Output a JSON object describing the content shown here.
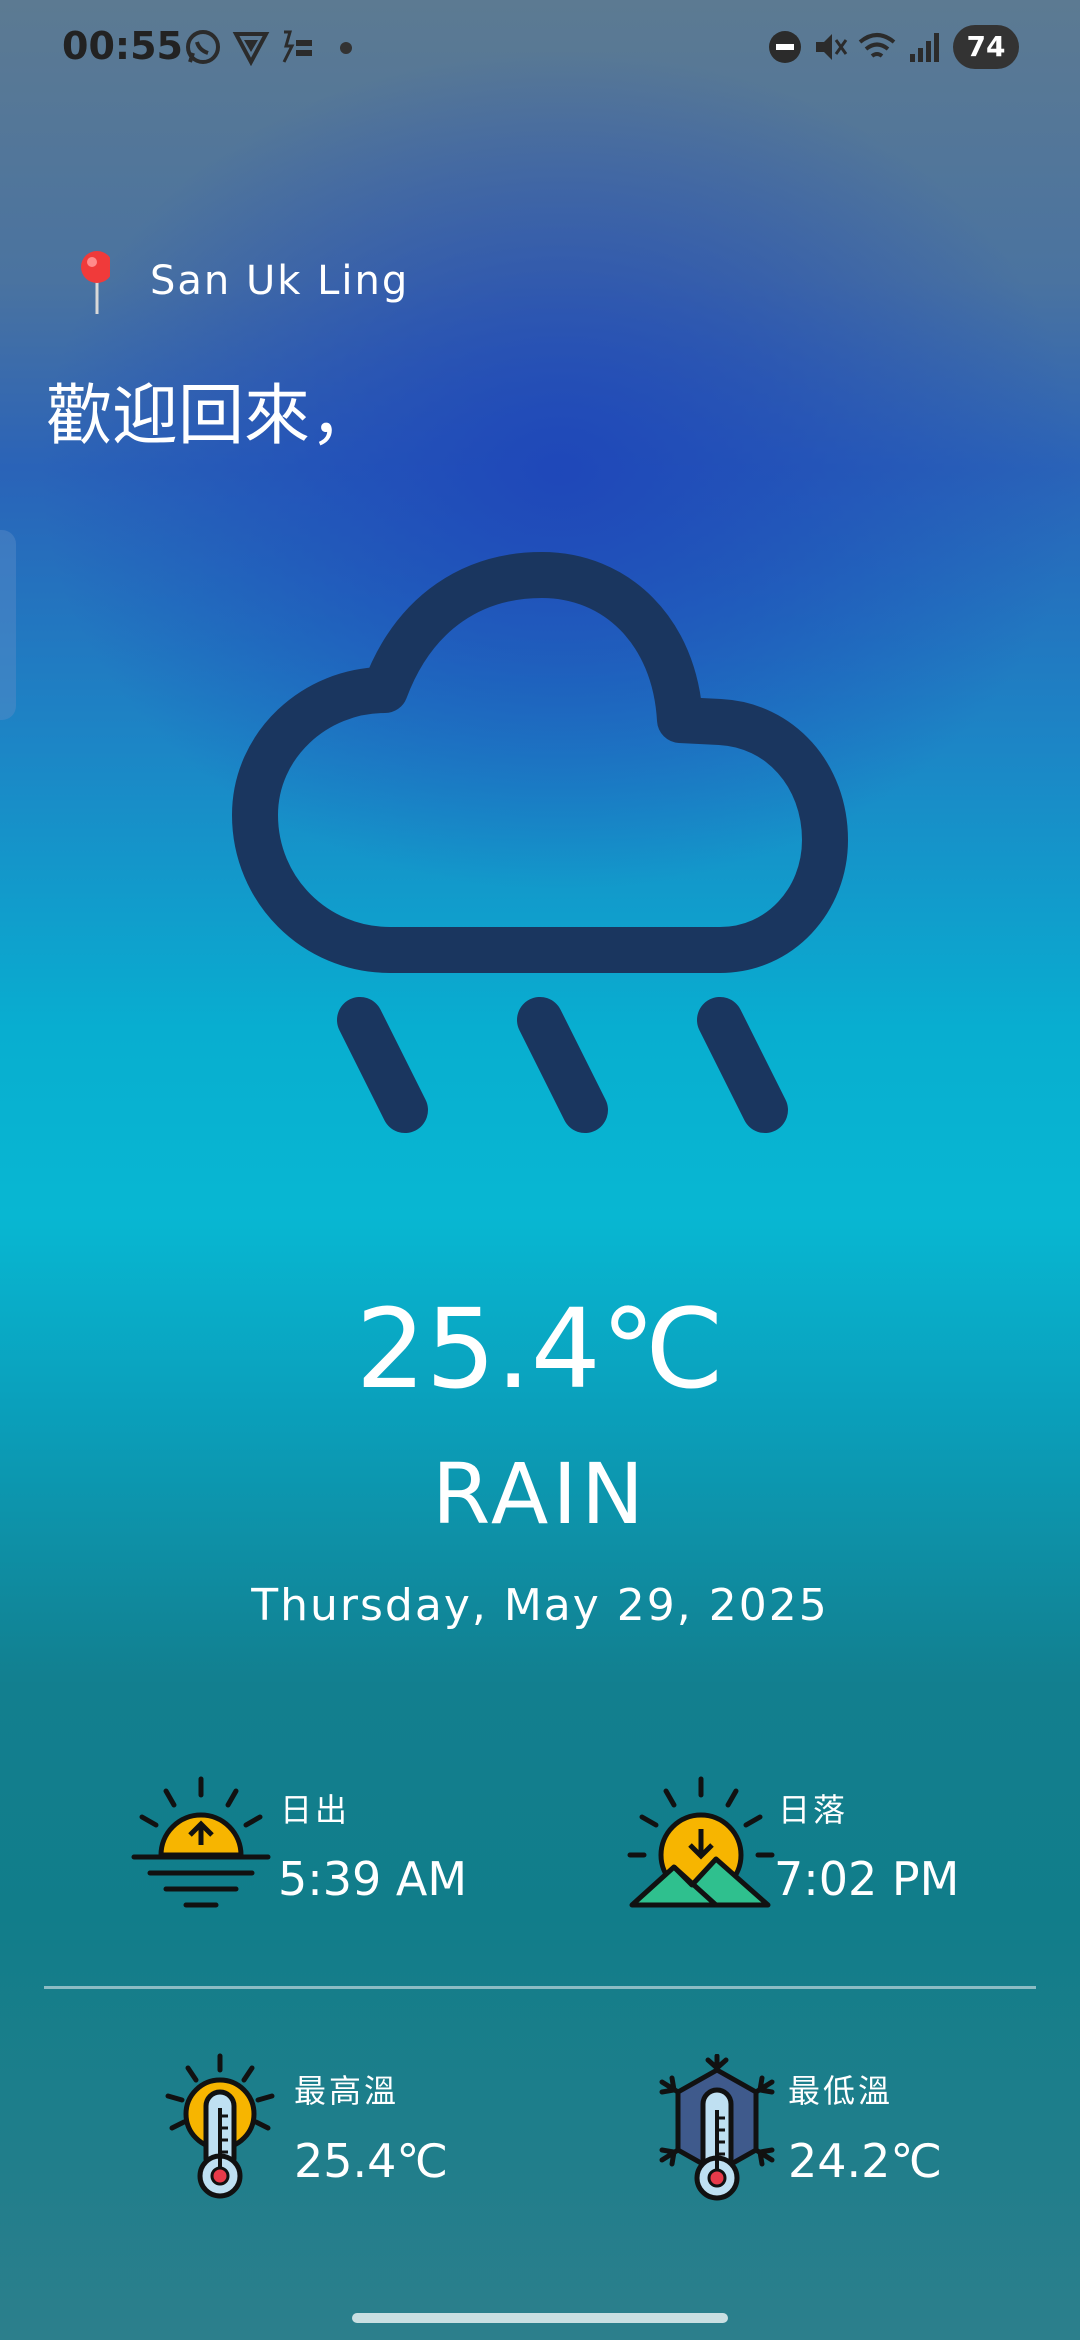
{
  "status_bar": {
    "time": "00:55",
    "battery": "74",
    "left_icons": [
      "whatsapp-icon",
      "shield-icon",
      "app-icon",
      "dot"
    ],
    "right_icons": [
      "dnd-icon",
      "mute-icon",
      "wifi-icon",
      "signal-icon",
      "battery-icon"
    ]
  },
  "header": {
    "location": "San Uk Ling",
    "greeting": "歡迎回來，"
  },
  "current": {
    "icon": "rain-cloud-icon",
    "temperature": "25.4℃",
    "condition": "RAIN",
    "date": "Thursday, May 29, 2025"
  },
  "stats": {
    "sunrise": {
      "label": "日出",
      "value": "5:39 AM",
      "icon": "sunrise-icon"
    },
    "sunset": {
      "label": "日落",
      "value": "7:02 PM",
      "icon": "sunset-icon"
    },
    "max_temp": {
      "label": "最高溫",
      "value": "25.4℃",
      "icon": "hot-thermometer-icon"
    },
    "min_temp": {
      "label": "最低溫",
      "value": "24.2℃",
      "icon": "cold-thermometer-icon"
    }
  },
  "colors": {
    "cloud_stroke": "#1a365f",
    "sun_yellow": "#f7b500",
    "mountain_green": "#2fc08e"
  }
}
